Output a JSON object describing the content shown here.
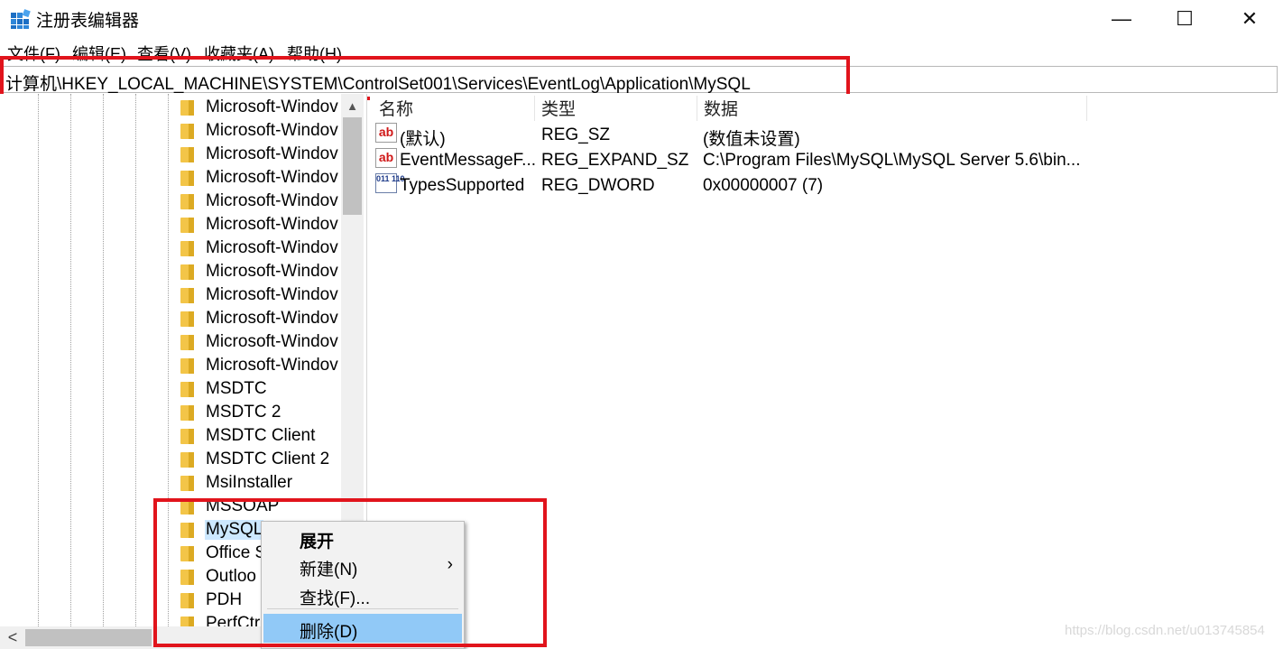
{
  "window": {
    "title": "注册表编辑器",
    "controls": {
      "minimize": "—",
      "maximize": "☐",
      "close": "✕"
    }
  },
  "menu": [
    "文件(F)",
    "编辑(E)",
    "查看(V)",
    "收藏夹(A)",
    "帮助(H)"
  ],
  "address": "计算机\\HKEY_LOCAL_MACHINE\\SYSTEM\\ControlSet001\\Services\\EventLog\\Application\\MySQL",
  "tree": {
    "items": [
      "Microsoft-Windov",
      "Microsoft-Windov",
      "Microsoft-Windov",
      "Microsoft-Windov",
      "Microsoft-Windov",
      "Microsoft-Windov",
      "Microsoft-Windov",
      "Microsoft-Windov",
      "Microsoft-Windov",
      "Microsoft-Windov",
      "Microsoft-Windov",
      "Microsoft-Windov",
      "MSDTC",
      "MSDTC 2",
      "MSDTC Client",
      "MSDTC Client 2",
      "MsiInstaller",
      "MSSOAP",
      "MySQL",
      "Office S",
      "Outloo",
      "PDH",
      "PerfCtr"
    ],
    "selected": "MySQL",
    "scroll_up_arrow": "▲",
    "scroll_left_arrow": "<"
  },
  "values": {
    "headers": {
      "name": "名称",
      "type": "类型",
      "data": "数据"
    },
    "rows": [
      {
        "icon": "string-value-icon",
        "icon_text": "ab",
        "name": "(默认)",
        "type": "REG_SZ",
        "data": "(数值未设置)"
      },
      {
        "icon": "string-value-icon",
        "icon_text": "ab",
        "name": "EventMessageF...",
        "type": "REG_EXPAND_SZ",
        "data": "C:\\Program Files\\MySQL\\MySQL Server 5.6\\bin..."
      },
      {
        "icon": "binary-value-icon",
        "icon_text": "011 110",
        "name": "TypesSupported",
        "type": "REG_DWORD",
        "data": "0x00000007 (7)"
      }
    ]
  },
  "context_menu": {
    "items": [
      {
        "label": "展开",
        "bold": true
      },
      {
        "label": "新建(N)",
        "submenu_arrow": "›"
      },
      {
        "label": "查找(F)..."
      },
      {
        "label": "删除(D)",
        "highlighted": true
      }
    ]
  },
  "watermark": "https://blog.csdn.net/u013745854",
  "colors": {
    "annotation_red": "#e1141c",
    "selection_blue": "#91c9f7",
    "folder_yellow": "#f3c548"
  }
}
